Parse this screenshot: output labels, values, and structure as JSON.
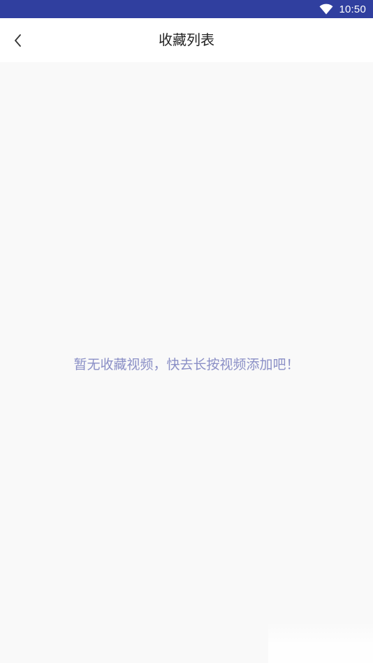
{
  "status_bar": {
    "time": "10:50",
    "wifi_icon": "wifi-icon",
    "background_color": "#303f9f"
  },
  "app_bar": {
    "back_icon": "chevron-left-icon",
    "title": "收藏列表"
  },
  "content": {
    "empty_message": "暂无收藏视频，快去长按视频添加吧！",
    "empty_message_color": "#8a8fc6"
  }
}
